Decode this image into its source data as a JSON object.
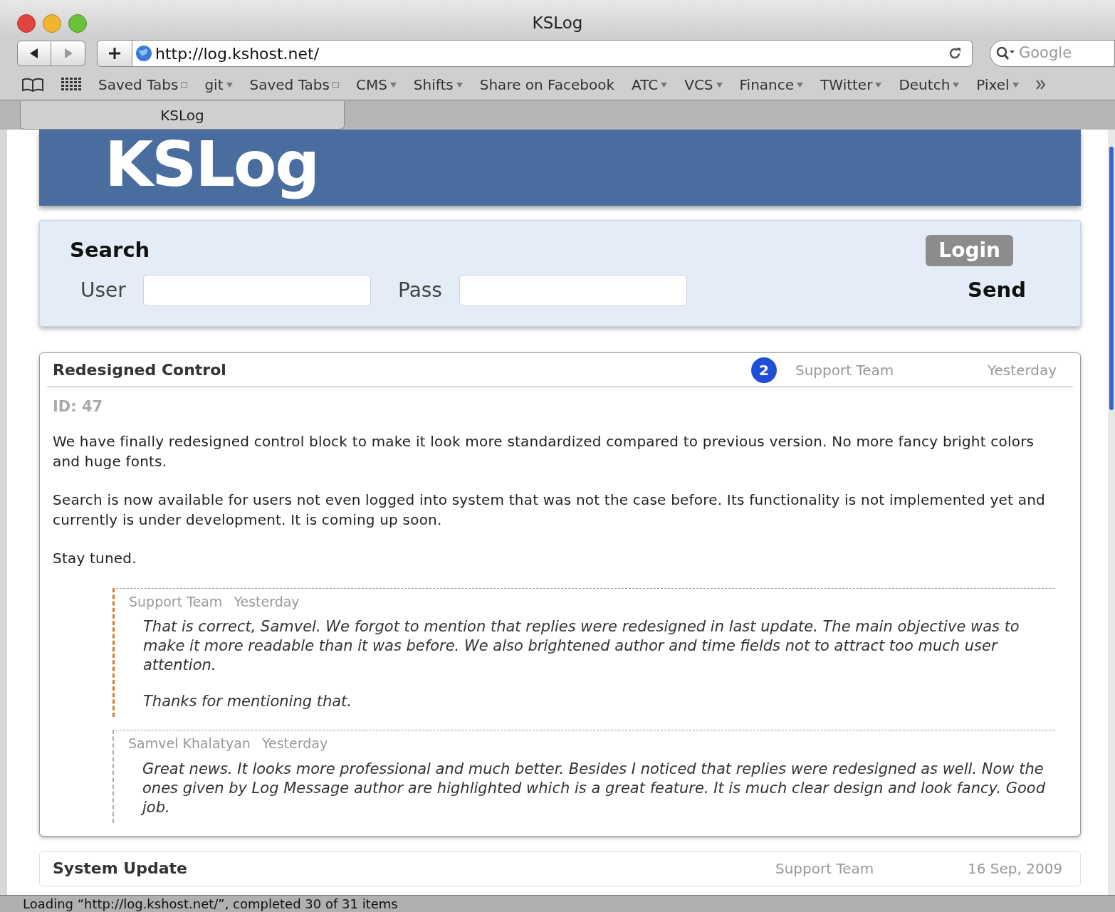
{
  "window": {
    "title": "KSLog"
  },
  "toolbar": {
    "address": "http://log.kshost.net/",
    "search_placeholder": "Google"
  },
  "bookmarks": [
    {
      "label": "Saved Tabs",
      "kind": "tabs"
    },
    {
      "label": "git",
      "kind": "menu"
    },
    {
      "label": "Saved Tabs",
      "kind": "tabs"
    },
    {
      "label": "CMS",
      "kind": "menu"
    },
    {
      "label": "Shifts",
      "kind": "menu"
    },
    {
      "label": "Share on Facebook",
      "kind": "link"
    },
    {
      "label": "ATC",
      "kind": "menu"
    },
    {
      "label": "VCS",
      "kind": "menu"
    },
    {
      "label": "Finance",
      "kind": "menu"
    },
    {
      "label": "TWitter",
      "kind": "menu"
    },
    {
      "label": "Deutch",
      "kind": "menu"
    },
    {
      "label": "Pixel",
      "kind": "menu"
    }
  ],
  "tabs": [
    {
      "label": "KSLog",
      "selected": true
    }
  ],
  "page": {
    "logo": "KSLog",
    "panel": {
      "search_label": "Search",
      "login_button": "Login",
      "user_label": "User",
      "pass_label": "Pass",
      "send_button": "Send"
    },
    "posts": [
      {
        "title": "Redesigned Control",
        "reply_count": "2",
        "author": "Support Team",
        "time": "Yesterday",
        "id": "ID: 47",
        "paragraphs": [
          "We have finally redesigned control block to make it look more standardized compared to previous version. No more fancy bright colors and huge fonts.",
          "Search is now available for users not even logged into system that was not the case before. Its functionality is not implemented yet and currently is under development. It is coming up soon.",
          "Stay tuned."
        ],
        "replies": [
          {
            "author": "Support Team",
            "time": "Yesterday",
            "highlighted": true,
            "paragraphs": [
              "That is correct, Samvel. We forgot to mention that replies were redesigned in last update. The main objective was to make it more readable than it was before. We also brightened author and time fields not to attract too much user attention.",
              "Thanks for mentioning that."
            ]
          },
          {
            "author": "Samvel Khalatyan",
            "time": "Yesterday",
            "highlighted": false,
            "paragraphs": [
              "Great news. It looks more professional and much better. Besides I noticed that replies were redesigned as well. Now the ones given by Log Message author are highlighted which is a great feature. It is much clear design and look fancy. Good job."
            ]
          }
        ]
      },
      {
        "title": "System Update",
        "author": "Support Team",
        "time": "16 Sep, 2009"
      }
    ]
  },
  "status_bar": "Loading “http://log.kshost.net/”, completed 30 of 31 items"
}
